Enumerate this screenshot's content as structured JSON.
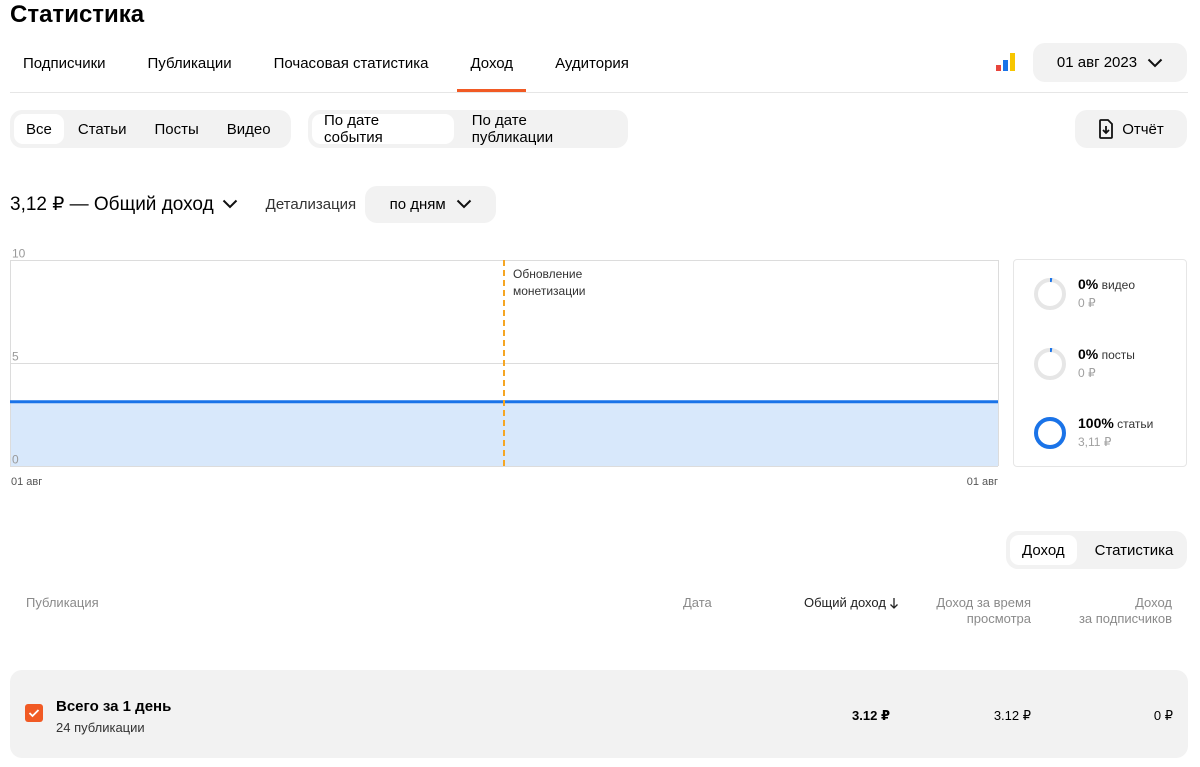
{
  "header": {
    "title": "Статистика"
  },
  "tabs": [
    {
      "label": "Подписчики"
    },
    {
      "label": "Публикации"
    },
    {
      "label": "Почасовая статистика"
    },
    {
      "label": "Доход",
      "active": true
    },
    {
      "label": "Аудитория"
    }
  ],
  "date_picker": {
    "value": "01 авг 2023"
  },
  "content_filter": {
    "items": [
      "Все",
      "Статьи",
      "Посты",
      "Видео"
    ],
    "active": "Все"
  },
  "date_mode": {
    "items": [
      "По дате события",
      "По дате публикации"
    ],
    "active": "По дате события"
  },
  "report_button": {
    "label": "Отчёт"
  },
  "summary": {
    "total_label": "3,12 ₽ — Общий доход",
    "detail_label": "Детализация",
    "detail_value": "по дням"
  },
  "chart_data": {
    "type": "area",
    "x": [
      "01 авг"
    ],
    "x_tick_labels": [
      "01 авг",
      "01 авг"
    ],
    "series": [
      {
        "values": [
          3.12
        ]
      }
    ],
    "ylim": [
      0,
      10
    ],
    "y_ticks": [
      0,
      5,
      10
    ],
    "annotations": [
      {
        "text": "Обновление\nмонетизации"
      }
    ],
    "grid": true
  },
  "breakdown": [
    {
      "percent": "0%",
      "label": "видео",
      "amount": "0 ₽",
      "share": 0
    },
    {
      "percent": "0%",
      "label": "посты",
      "amount": "0 ₽",
      "share": 0
    },
    {
      "percent": "100%",
      "label": "статьи",
      "amount": "3,11 ₽",
      "share": 1
    }
  ],
  "table_toggle": {
    "items": [
      "Доход",
      "Статистика"
    ],
    "active": "Доход"
  },
  "table": {
    "headers": {
      "publication": "Публикация",
      "date": "Дата",
      "total": "Общий доход",
      "view_time": [
        "Доход за время",
        "просмотра"
      ],
      "subscribers": [
        "Доход",
        "за подписчиков"
      ]
    },
    "total_row": {
      "title": "Всего за 1 день",
      "subtitle": "24 публикации",
      "total": "3.12 ₽",
      "view_time": "3.12 ₽",
      "subscribers": "0 ₽"
    }
  },
  "colors": {
    "accent": "#f15a24",
    "chart_line": "#1a73e8",
    "chart_fill": "#d8e8fb",
    "annotation": "#f5a623",
    "ring_track": "#e6e6e6",
    "ring_value": "#1a73e8"
  }
}
